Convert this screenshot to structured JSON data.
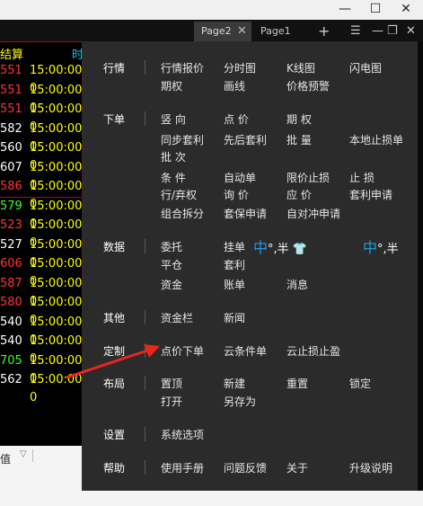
{
  "tabs": {
    "page2": "Page2",
    "page1": "Page1",
    "close": "✕",
    "add": "+"
  },
  "window": {
    "minimize": "—",
    "maximize": "☐",
    "close": "✕"
  },
  "toolbar": {
    "list": "☰",
    "dash": "—",
    "restore": "❐",
    "close": "✕"
  },
  "background": {
    "header_left": "结算",
    "header_right": "时",
    "rows": [
      {
        "code": "551",
        "color": "#ff3333",
        "time": "15:00:00 0"
      },
      {
        "code": "551",
        "color": "#ff3333",
        "time": "15:00:00 0"
      },
      {
        "code": "551",
        "color": "#ff3333",
        "time": "15:00:00 0"
      },
      {
        "code": "582",
        "color": "#ffffff",
        "time": "15:00:00 0"
      },
      {
        "code": "560",
        "color": "#ffffff",
        "time": "15:00:00 0"
      },
      {
        "code": "607",
        "color": "#ffffff",
        "time": "15:00:00 0"
      },
      {
        "code": "586",
        "color": "#ff3333",
        "time": "15:00:00 0"
      },
      {
        "code": "579",
        "color": "#33ff33",
        "time": "15:00:00 0"
      },
      {
        "code": "523",
        "color": "#ff3333",
        "time": "15:00:00 0"
      },
      {
        "code": "527",
        "color": "#ffffff",
        "time": "15:00:00 0"
      },
      {
        "code": "606",
        "color": "#ff3333",
        "time": "15:00:00 0"
      },
      {
        "code": "587",
        "color": "#ff3333",
        "time": "15:00:00 0"
      },
      {
        "code": "580",
        "color": "#ff3333",
        "time": "15:00:00 0"
      },
      {
        "code": "540",
        "color": "#ffffff",
        "time": "15:00:00 0"
      },
      {
        "code": "540",
        "color": "#ffffff",
        "time": "15:00:00 0"
      },
      {
        "code": "705",
        "color": "#33ff33",
        "time": "15:00:00 0"
      },
      {
        "code": "562",
        "color": "#ffffff",
        "time": "15:00:00 0"
      }
    ],
    "footer_label": "值"
  },
  "menu": {
    "categories": {
      "quote": "行情",
      "order": "下单",
      "data": "数据",
      "other": "其他",
      "custom": "定制",
      "layout": "布局",
      "settings": "设置",
      "help": "帮助"
    },
    "quote": [
      "行情报价",
      "分时图",
      "K线图",
      "闪电图",
      "期权",
      "画线",
      "价格预警"
    ],
    "order": [
      "竖 向",
      "点 价",
      "期 权",
      "同步套利",
      "先后套利",
      "批 量",
      "本地止损单",
      "批 次",
      "条 件",
      "自动单",
      "限价止损",
      "止 损",
      "行/弃权",
      "询 价",
      "应 价",
      "套利申请",
      "组合拆分",
      "套保申请",
      "自对冲申请"
    ],
    "data": [
      "委托",
      "挂单",
      "平仓",
      "套利",
      "资金",
      "账单",
      "消息"
    ],
    "ime_text": "中°,半",
    "other": [
      "资金栏",
      "新闻"
    ],
    "custom": [
      "点价下单",
      "云条件单",
      "云止损止盈"
    ],
    "layout": [
      "置顶",
      "新建",
      "重置",
      "锁定",
      "打开",
      "另存为"
    ],
    "settings": [
      "系统选项"
    ],
    "help": [
      "使用手册",
      "问题反馈",
      "关于",
      "升级说明"
    ]
  },
  "annotation_color": "#e8261c"
}
